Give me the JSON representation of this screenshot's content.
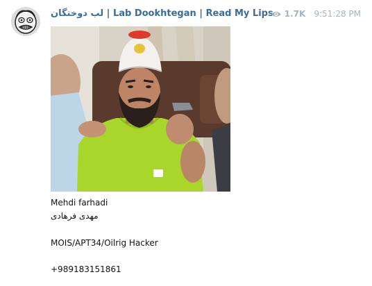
{
  "channel": {
    "name": "لب دوختگان | Lab Dookhtegan | Read My Lips"
  },
  "post": {
    "views": "1.7K",
    "time": "9:51:28 PM",
    "caption_lines": [
      "Mehdi farhadi",
      "مهدی فرهادی",
      "",
      "MOIS/APT34/Oilrig Hacker",
      "",
      "+989183151861"
    ]
  },
  "icons": {
    "views": "eye-icon",
    "avatar": "channel-avatar"
  },
  "colors": {
    "channel_name": "#3a6d99",
    "meta_text": "#a8b3bd",
    "shirt": "#a8d62a"
  }
}
